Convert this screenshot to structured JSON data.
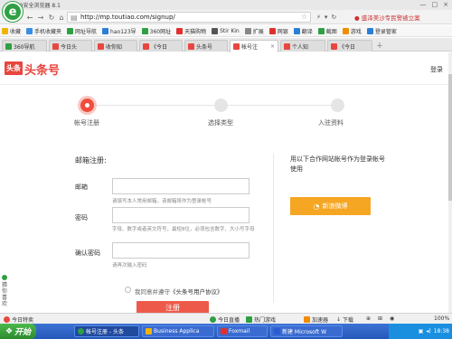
{
  "browser": {
    "window_title": "360安全浏览器 8.1",
    "logo_letter": "e",
    "url": "http://mp.toutiao.com/signup/",
    "news_ticker": "● 盛泽美沙专民警被立案",
    "window_controls": [
      "—",
      "□",
      "×"
    ],
    "nav_icons": [
      "←",
      "→",
      "↻",
      "⌂"
    ],
    "nav_right": [
      "⚡",
      "▾",
      "↻"
    ]
  },
  "bookmarks": [
    {
      "label": "收藏",
      "color": "#f0b400"
    },
    {
      "label": "手机收藏夹",
      "color": "#3a8ee6"
    },
    {
      "label": "网址导航",
      "color": "#2ea043"
    },
    {
      "label": "hao123导",
      "color": "#2a7fd4"
    },
    {
      "label": "360网址",
      "color": "#2ea043"
    },
    {
      "label": "天猫购物",
      "color": "#e0302d"
    },
    {
      "label": "Stir Kin",
      "color": "#555"
    },
    {
      "label": "扩展",
      "color": "#888"
    },
    {
      "label": "网银",
      "color": "#e0302d"
    },
    {
      "label": "翻译",
      "color": "#2a7fd4"
    },
    {
      "label": "截图",
      "color": "#2ea043"
    },
    {
      "label": "游戏",
      "color": "#f08c00"
    },
    {
      "label": "登录管家",
      "color": "#2a7fd4"
    }
  ],
  "tabs": [
    {
      "label": "360导航",
      "color": "#2ea043"
    },
    {
      "label": "今日头",
      "color": "#e8463e"
    },
    {
      "label": "收你知",
      "color": "#e8463e"
    },
    {
      "label": "《今日",
      "color": "#e8463e"
    },
    {
      "label": "头条号",
      "color": "#e8463e"
    },
    {
      "label": "帐号注",
      "color": "#e8463e"
    },
    {
      "label": "个人知",
      "color": "#e8463e"
    },
    {
      "label": "《今日",
      "color": "#e8463e"
    }
  ],
  "page": {
    "brand_mark": "头条",
    "brand_name": "头条号",
    "login": "登录",
    "steps": [
      "帐号注册",
      "选择类型",
      "入驻资料"
    ],
    "form_title": "邮箱注册:",
    "fields": [
      {
        "label": "邮箱",
        "hint": "请填写本人常用邮箱，该邮箱将作为登录帐号"
      },
      {
        "label": "密码",
        "hint": "字母、数字或者英文符号，最短8位，必须包含数字、大小写字母"
      },
      {
        "label": "确认密码",
        "hint": "请再次输入密码"
      }
    ],
    "agree_prefix": "我同意并遵守",
    "agree_link": "《头条号用户协议》",
    "register": "注册",
    "partner_text": "用以下合作网站帐号作为登录帐号使用",
    "weibo_button": "新浪微博"
  },
  "side_widget": "猜你喜欢",
  "statusbar": {
    "left": "今日特卖",
    "items": [
      "今日直播",
      "热门游戏",
      "加速器",
      "下载",
      "⊕",
      "⊞",
      "◉",
      "100%"
    ]
  },
  "taskbar": {
    "start": "开始",
    "tasks": [
      "帐号注册 - 头条",
      "Business Applica",
      "Foxmail",
      "新建 Microsoft W"
    ],
    "clock": "18:38"
  },
  "colors": {
    "brand_red": "#e8463e",
    "weibo_orange": "#f5a623",
    "taskbar_blue": "#2457b8"
  }
}
